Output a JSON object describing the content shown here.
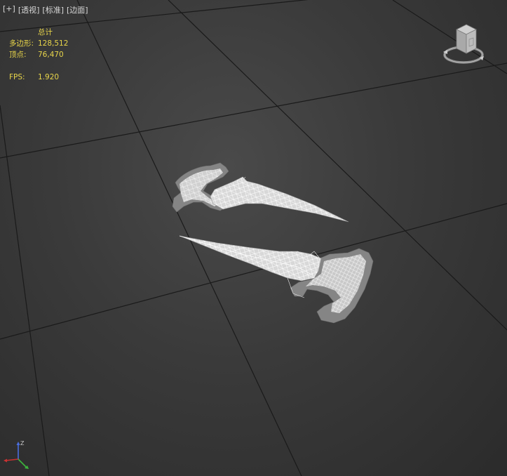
{
  "viewport_menu": {
    "plus": "[+]",
    "view_mode": "[透视]",
    "shading": "[标准]",
    "edges": "[边面]"
  },
  "stats": {
    "total_label": "总计",
    "polygons_label": "多边形:",
    "polygons_value": "128,512",
    "vertices_label": "顶点:",
    "vertices_value": "76,470",
    "fps_label": "FPS:",
    "fps_value": "1.920"
  },
  "axis_gizmo": {
    "z_label": "Z"
  },
  "colors": {
    "stats_text": "#e8d54a",
    "menu_text": "#d8d8d8",
    "grid_line": "#1a1a1a",
    "wireframe": "#ffffff",
    "model_fill": "#8a8a8a",
    "axis_x": "#c83232",
    "axis_y": "#3cb43c",
    "axis_z": "#4a6ee0"
  },
  "icons": {
    "viewcube": "viewcube-icon",
    "axis_gizmo": "xyz-axis-gizmo-icon"
  }
}
